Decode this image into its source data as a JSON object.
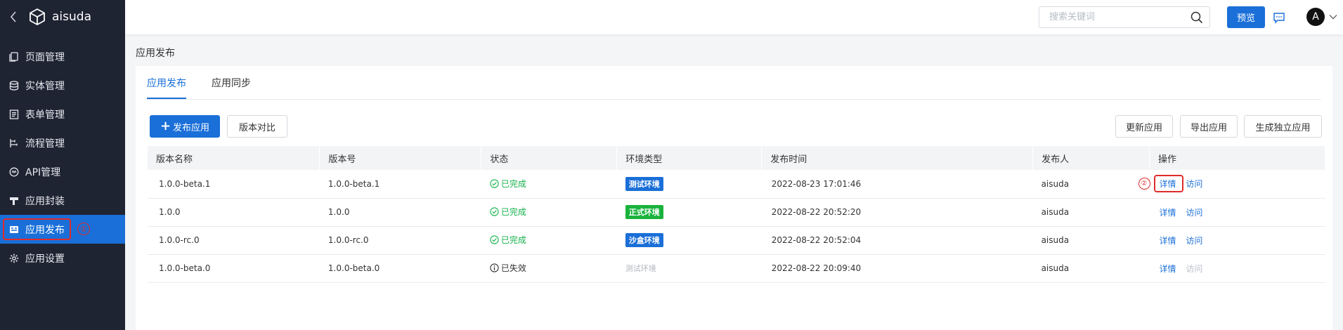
{
  "app": {
    "name": "aisuda"
  },
  "sidebar": {
    "items": [
      {
        "label": "页面管理",
        "icon": "pages-icon"
      },
      {
        "label": "实体管理",
        "icon": "database-icon"
      },
      {
        "label": "表单管理",
        "icon": "form-icon"
      },
      {
        "label": "流程管理",
        "icon": "flow-icon"
      },
      {
        "label": "API管理",
        "icon": "api-icon"
      },
      {
        "label": "应用封装",
        "icon": "package-icon"
      },
      {
        "label": "应用发布",
        "icon": "publish-icon",
        "active": true,
        "annotation": "①"
      },
      {
        "label": "应用设置",
        "icon": "gear-icon"
      }
    ]
  },
  "header": {
    "search_placeholder": "搜索关键词",
    "preview_label": "预览",
    "avatar_letter": "A"
  },
  "page": {
    "title": "应用发布"
  },
  "tabs": [
    {
      "label": "应用发布",
      "active": true
    },
    {
      "label": "应用同步",
      "active": false
    }
  ],
  "toolbar": {
    "publish_label": "发布应用",
    "compare_label": "版本对比",
    "update_label": "更新应用",
    "export_label": "导出应用",
    "standalone_label": "生成独立应用"
  },
  "table": {
    "columns": [
      "版本名称",
      "版本号",
      "状态",
      "环境类型",
      "发布时间",
      "发布人",
      "操作"
    ],
    "rows": [
      {
        "name": "1.0.0-beta.1",
        "version": "1.0.0-beta.1",
        "status": "已完成",
        "status_type": "done",
        "env": "测试环境",
        "env_type": "test",
        "time": "2022-08-23 17:01:46",
        "publisher": "aisuda",
        "detail": "详情",
        "visit": "访问",
        "visit_enabled": true,
        "annotation": "②"
      },
      {
        "name": "1.0.0",
        "version": "1.0.0",
        "status": "已完成",
        "status_type": "done",
        "env": "正式环境",
        "env_type": "prod",
        "time": "2022-08-22 20:52:20",
        "publisher": "aisuda",
        "detail": "详情",
        "visit": "访问",
        "visit_enabled": true
      },
      {
        "name": "1.0.0-rc.0",
        "version": "1.0.0-rc.0",
        "status": "已完成",
        "status_type": "done",
        "env": "沙盒环境",
        "env_type": "sandbox",
        "time": "2022-08-22 20:52:04",
        "publisher": "aisuda",
        "detail": "详情",
        "visit": "访问",
        "visit_enabled": true
      },
      {
        "name": "1.0.0-beta.0",
        "version": "1.0.0-beta.0",
        "status": "已失效",
        "status_type": "invalid",
        "env": "测试环境",
        "env_type": "muted",
        "time": "2022-08-22 20:09:40",
        "publisher": "aisuda",
        "detail": "详情",
        "visit": "访问",
        "visit_enabled": false
      }
    ]
  },
  "colors": {
    "accent": "#1a6fd8",
    "sidebar_bg": "#1f2433",
    "success": "#14b24a",
    "prod_env": "#1ab23c",
    "annotation": "#e02b2b"
  }
}
